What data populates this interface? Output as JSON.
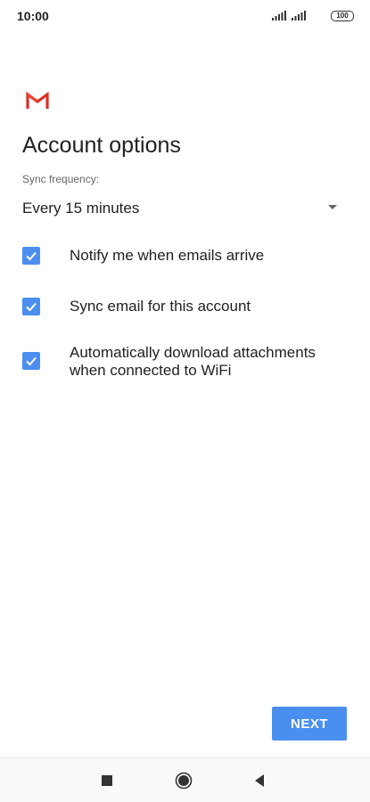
{
  "status_bar": {
    "time": "10:00",
    "battery": "100"
  },
  "logo": {
    "icon": "gmail-m-icon",
    "colors": [
      "#d93025",
      "#ea4335"
    ]
  },
  "page": {
    "title": "Account options"
  },
  "sync": {
    "label": "Sync frequency:",
    "value": "Every 15 minutes"
  },
  "options": [
    {
      "label": "Notify me when emails arrive",
      "checked": true
    },
    {
      "label": "Sync email for this account",
      "checked": true
    },
    {
      "label": "Automatically download attachments when connected to WiFi",
      "checked": true
    }
  ],
  "actions": {
    "next_label": "NEXT"
  },
  "colors": {
    "accent": "#4a8ff0"
  },
  "nav": {
    "icons": [
      "recent-apps-icon",
      "home-icon",
      "back-icon"
    ]
  }
}
